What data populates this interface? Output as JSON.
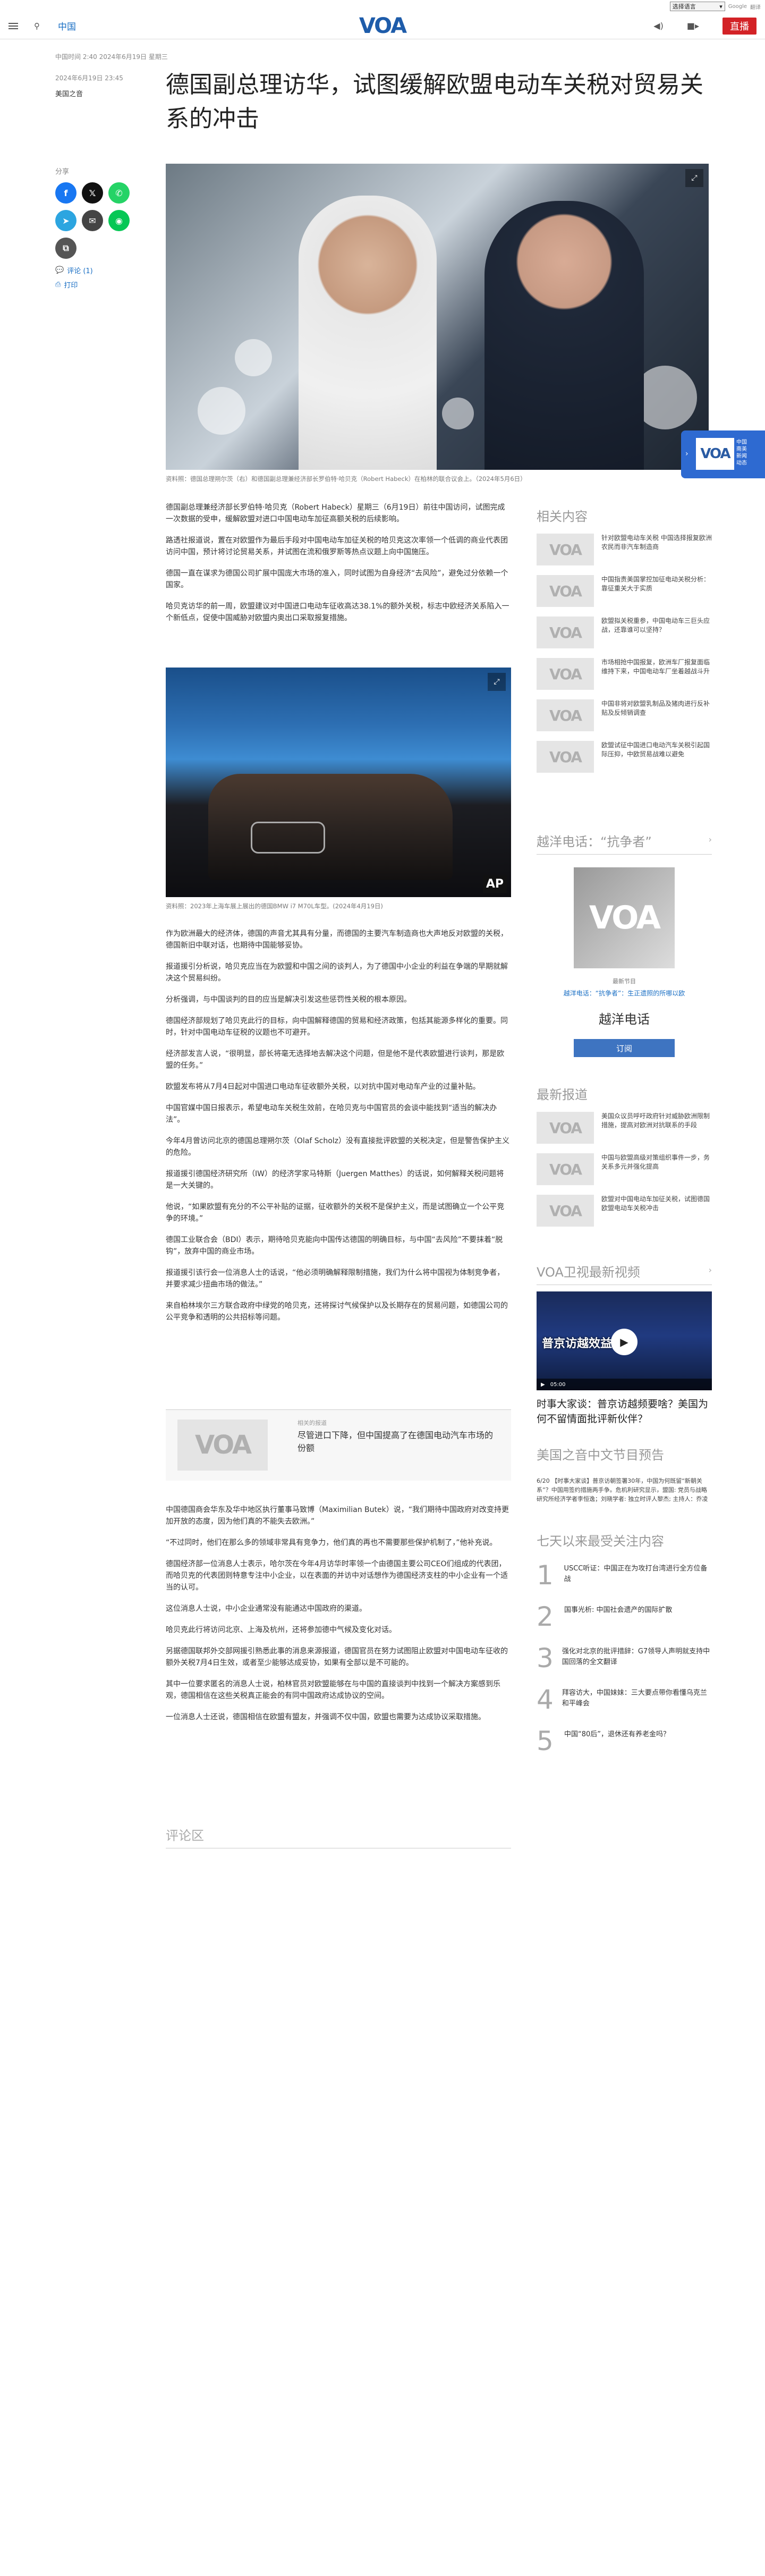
{
  "topbar": {
    "language_select": "选择语言",
    "google_label": "Google",
    "translate_label": "翻译"
  },
  "header": {
    "nav_label": "中国",
    "logo": "VOA",
    "live_label": "直播"
  },
  "article": {
    "meta": "中国时间 2:40 2024年6月19日 星期三",
    "date_line": "2024年6月19日 23:45",
    "author": "美国之音",
    "title": "德国副总理访华，试图缓解欧盟电动车关税对贸易关系的冲击",
    "hero_caption": "资料照：德国总理朔尔茨（右）和德国副总理兼经济部长罗伯特·哈贝克（Robert Habeck）在柏林的联合议会上。（2024年5月6日）",
    "car_caption": "资料照：2023年上海车展上展出的德国BMW i7 M70L车型。(2024年4月19日)",
    "paragraphs_a": [
      "德国副总理兼经济部长罗伯特·哈贝克（Robert Habeck）星期三（6月19日）前往中国访问，试图完成一次数据的受申，缓解欧盟对进口中国电动车加征高额关税的后续影响。",
      "路透社报道说，置在对欧盟作为最后手段对中国电动车加征关税的哈贝克这次率领一个低调的商业代表团访问中国，预计将讨论贸易关系，并试图在流和俄罗斯等热点议题上向中国施压。",
      "德国一直在谋求为德国公司扩展中国庞大市场的准入，同时试图为自身经济“去风险”，避免过分依赖一个国家。",
      "哈贝克访华的前一周，欧盟建议对中国进口电动车征收高达38.1%的额外关税，标志中欧经济关系陷入一个新低点，促使中国威胁对欧盟内奥出口采取报复措施。"
    ],
    "paragraphs_b": [
      "作为欧洲最大的经济体，德国的声音尤其具有分量，而德国的主要汽车制造商也大声地反对欧盟的关税，德国新旧中联对话，也期待中国能够妥协。",
      "报道援引分析说，哈贝克应当在为欧盟和中国之间的谈判人，为了德国中小企业的利益在争端的早期就解决这个贸易纠纷。",
      "分析强调，与中国谈判的目的应当是解决引发这些惩罚性关税的根本原因。",
      "德国经济部规划了哈贝克此行的目标，向中国解释德国的贸易和经济政策，包括其能源多样化的重要。同时，针对中国电动车征税的议题也不可避开。",
      "经济部发言人说，“很明显，部长将毫无选择地去解决这个问题，但是他不是代表欧盟进行谈判，那是欧盟的任务。”",
      "欧盟发布将从7月4日起对中国进口电动车征收额外关税，以对抗中国对电动车产业的过量补贴。",
      "中国官媒中国日报表示，希望电动车关税生效前，在哈贝克与中国官员的会谈中能找到“适当的解决办法”。",
      "今年4月曾访问北京的德国总理朔尔茨（Olaf Scholz）没有直接批评欧盟的关税决定，但是警告保护主义的危险。",
      "报道援引德国经济研究所（IW）的经济学家马特斯（Juergen Matthes）的话说，如何解释关税问题将是一大关键的。",
      "他说，“如果欧盟有充分的不公平补贴的证据，征收额外的关税不是保护主义，而是试图确立一个公平竞争的环境。”",
      "德国工业联合会（BDI）表示，期待哈贝克能向中国传达德国的明确目标，与中国“去风险”不要抹着“脱钩”，放弃中国的商业市场。",
      "报道援引该行会一位消息人士的话说，“他必须明确解释限制措施，我们为什么将中国视为体制竞争者，并要求减少扭曲市场的做法。”",
      "来自柏林埃尔三方联合政府中绿党的哈贝克，还将探讨气候保护以及长期存在的贸易问题，如德国公司的公平竞争和透明的公共招标等问题。"
    ],
    "pull_kicker": "相关的报道",
    "pull_title": "尽管进口下降，但中国提高了在德国电动汽车市场的份额",
    "paragraphs_c": [
      "中国德国商会华东及华中地区执行董事马致博（Maximilian Butek）说，“我们期待中国政府对改变持更加开放的态度，因为他们真的不能失去欧洲。”",
      "“不过同时，他们在那么多的领域非常具有竞争力，他们真的再也不需要那些保护机制了，”他补充说。",
      "德国经济部一位消息人士表示，哈尔茨在今年4月访华时率领一个由德国主要公司CEO们组成的代表团，而哈贝克的代表团则特意专注中小企业，以在表面的并访中对话想作为德国经济支柱的中小企业有一个适当的认可。",
      "这位消息人士说，中小企业通常没有能通达中国政府的渠道。",
      "哈贝克此行将访问北京、上海及杭州，还将参加德中气候及变化对话。",
      "另据德国联邦外交部网援引熟悉此事的消息来源报道，德国官员在努力试图阻止欧盟对中国电动车征收的额外关税7月4日生效，或者至少能够达成妥协，如果有全部以是不可能的。",
      "其中一位要求匿名的消息人士说，柏林官员对欧盟能够在与中国的直接谈判中找到一个解决方案感到乐观，德国相信在这些关税真正能会的有同中国政府达成协议的空间。",
      "一位消息人士还说，德国相信在欧盟有盟友，并强调不仅中国，欧盟也需要为达成协议采取措施。"
    ],
    "comments_label": "评论区"
  },
  "share": {
    "label": "分享",
    "comments": "评论 (1)",
    "print": "打印"
  },
  "related": {
    "title": "相关内容",
    "items": [
      "针对欧盟电动车关税 中国选择报复欧洲农民而非汽车制造商",
      "中国指责美国掌控加征电动关税分析：靠征重关大于实质",
      "欧盟拟关税重参，中国电动车三巨头应战，还靠谁可以坚持？",
      "市场相抢中国报复，欧洲车厂报复面临维持下来，中国电动车厂坐着越战斗升",
      "中国非将对欧盟乳制品及猪肉进行反补贴及反倾销调查",
      "欧盟试征中国进口电动汽车关税引起国际压抑，中欧贸易战难以避免"
    ]
  },
  "podcast": {
    "title": "越洋电话：“抗争者”",
    "latest_label": "最新节目",
    "latest_link": "越洋电话：“抗争者”：生正遗照的所哪以欧",
    "name": "越洋电话",
    "subscribe": "订阅"
  },
  "latest": {
    "title": "最新报道",
    "items": [
      "美国众议员呼吁政府针对威胁欧洲限制措施，提高对欧洲对抗联系的手段",
      "中国与欧盟高级对策组织事件一步，务关系多元并强化提高",
      "欧盟对中国电动车加征关税，试图德国欧盟电动车关税冲击"
    ]
  },
  "video": {
    "title": "VOA卫视最新视频",
    "overlay": "普京访越效益",
    "time": "05:00",
    "caption": "时事大家谈：普京访越频要啥？美国为何不留情面批评新伙伴？"
  },
  "program": {
    "title": "美国之音中文节目预告",
    "text": "6/20 【时事大家谈】普京访朝签署30年，中国为何既留“新朝关系”？中国用签约措施两手争。危机利研究显示，盟国: 党员与战略研究所经济学者李恒逸；刘晓学者: 独立时评人黎杰; 主持人：乔凌"
  },
  "top7": {
    "title": "七天以来最受关注内容",
    "items": [
      {
        "num": "1",
        "text": "USCC听证：中国正在为攻打台湾进行全方位备战"
      },
      {
        "num": "2",
        "text": "国事光析: 中国社会遗产的国际扩散"
      },
      {
        "num": "3",
        "text": "强化对北京的批评措辞：G7领导人声明就支持中国回落的全文翻译"
      },
      {
        "num": "4",
        "text": "拜容访大，中国妹妹：三大要点带你看懂乌克兰和平峰会"
      },
      {
        "num": "5",
        "text": "中国“80后”，退休还有养老金吗？"
      }
    ]
  },
  "float": {
    "logo": "VOA",
    "text": "中国\n南美\n新闻\n动态"
  }
}
